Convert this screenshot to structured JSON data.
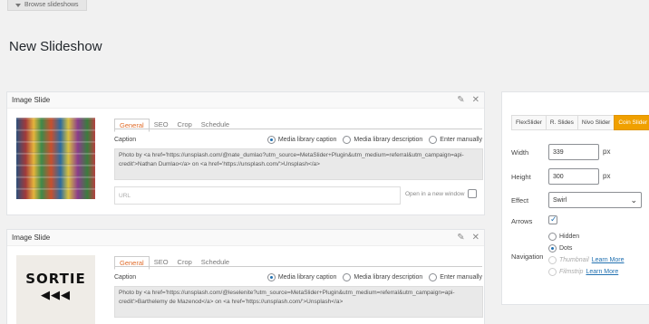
{
  "browse": {
    "label": "Browse slideshows"
  },
  "page": {
    "title": "New Slideshow"
  },
  "slides": [
    {
      "title": "Image Slide",
      "tabs": [
        "General",
        "SEO",
        "Crop",
        "Schedule"
      ],
      "caption_label": "Caption",
      "radio_options": [
        "Media library caption",
        "Media library description",
        "Enter manually"
      ],
      "caption_text": "Photo by <a href='https://unsplash.com/@nate_dumlao?utm_source=MetaSlider+Plugin&utm_medium=referral&utm_campaign=api-credit'>Nathan Dumlao</a> on <a href='https://unsplash.com/'>Unsplash</a>",
      "url_placeholder": "URL",
      "new_window_label": "Open in a new window"
    },
    {
      "title": "Image Slide",
      "thumb_word": "SORTIE",
      "thumb_arrows": "◀◀◀",
      "tabs": [
        "General",
        "SEO",
        "Crop",
        "Schedule"
      ],
      "caption_label": "Caption",
      "radio_options": [
        "Media library caption",
        "Media library description",
        "Enter manually"
      ],
      "caption_text": "Photo by <a href='https://unsplash.com/@leselenite?utm_source=MetaSlider+Plugin&utm_medium=referral&utm_campaign=api-credit'>Barthelemy de Mazenod</a> on <a href='https://unsplash.com/'>Unsplash</a>"
    }
  ],
  "settings": {
    "tabs": [
      "FlexSlider",
      "R. Slides",
      "Nivo Slider",
      "Coin Slider"
    ],
    "active_tab": "Coin Slider",
    "width_label": "Width",
    "width_value": "339",
    "height_label": "Height",
    "height_value": "300",
    "unit": "px",
    "effect_label": "Effect",
    "effect_value": "Swirl",
    "arrows_label": "Arrows",
    "navigation_label": "Navigation",
    "nav_hidden": "Hidden",
    "nav_dots": "Dots",
    "nav_thumbnail": "Thumbnail",
    "nav_filmstrip": "Filmstrip",
    "learn_more": "Learn More"
  },
  "colors": {
    "accent": "#e06c2a",
    "active_tab": "#f0a000",
    "link": "#2271b1"
  }
}
